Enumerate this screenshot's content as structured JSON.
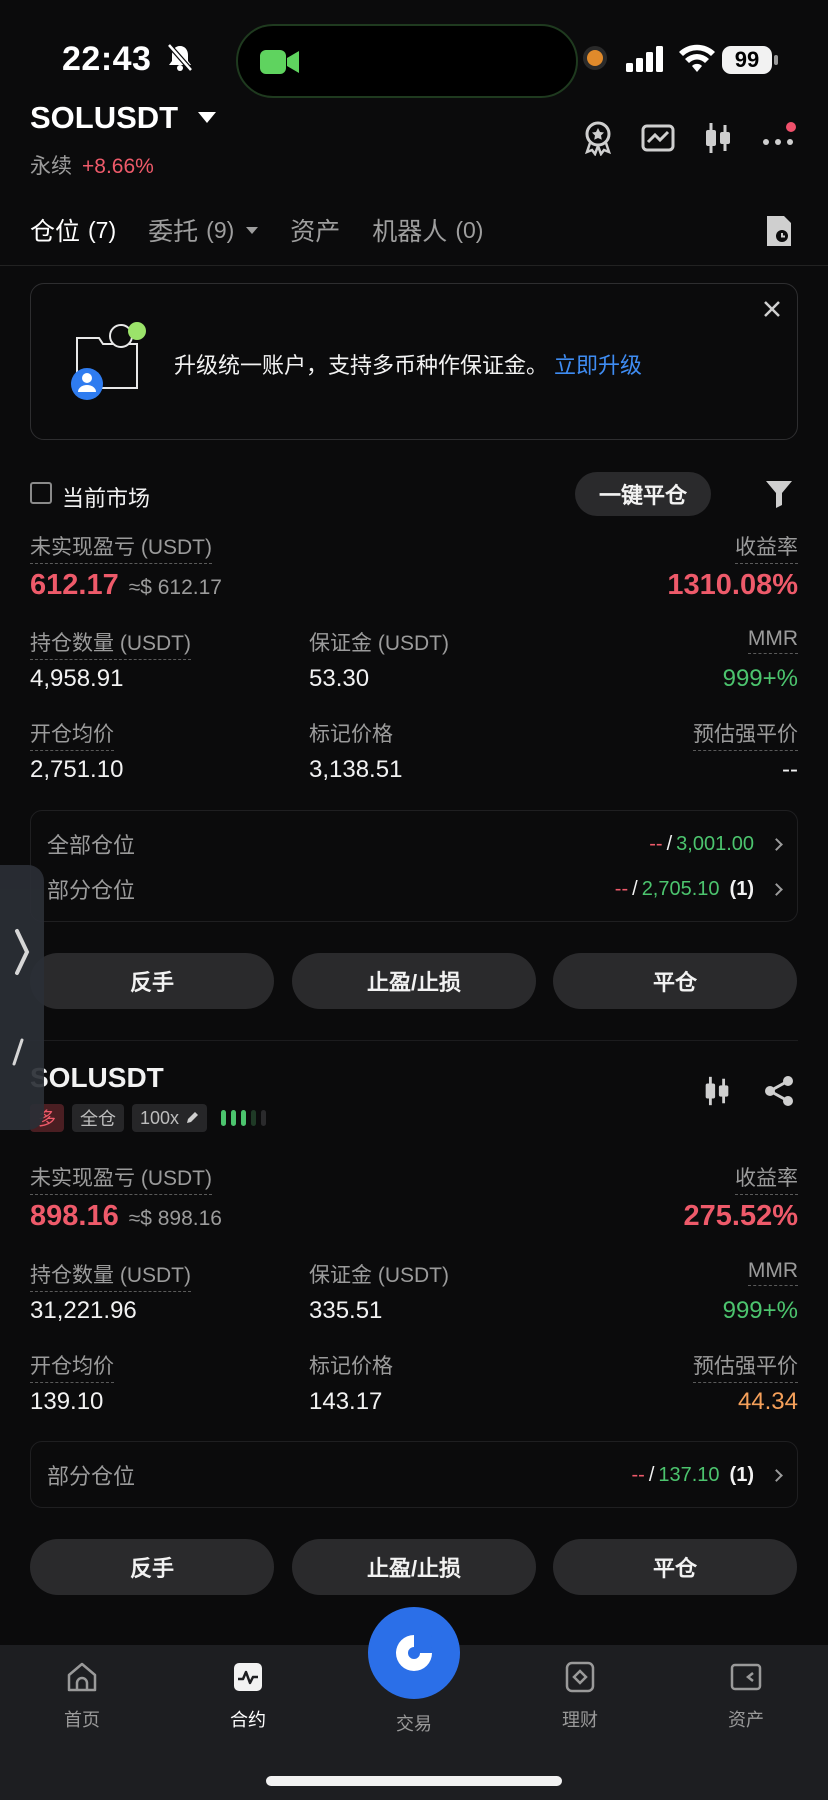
{
  "status_bar": {
    "time": "22:43",
    "battery": "99"
  },
  "header": {
    "symbol": "SOLUSDT",
    "type": "永续",
    "change": "+8.66%"
  },
  "tabs": [
    {
      "label": "仓位",
      "count": "(7)"
    },
    {
      "label": "委托",
      "count": "(9)"
    },
    {
      "label": "资产",
      "count": ""
    },
    {
      "label": "机器人",
      "count": "(0)"
    }
  ],
  "banner": {
    "text": "升级统一账户，支持多币种作保证金。",
    "link": "立即升级"
  },
  "filter_row": {
    "current_market": "当前市场",
    "close_all": "一键平仓"
  },
  "labels": {
    "unrealized": "未实现盈亏 (USDT)",
    "roe": "收益率",
    "size": "持仓数量 (USDT)",
    "margin": "保证金 (USDT)",
    "mmr": "MMR",
    "entry": "开仓均价",
    "mark": "标记价格",
    "liq": "预估强平价"
  },
  "position1": {
    "pnl": "612.17",
    "pnl_approx": "≈$ 612.17",
    "roe": "1310.08%",
    "size": "4,958.91",
    "margin": "53.30",
    "mmr": "999+%",
    "entry": "2,751.10",
    "mark": "3,138.51",
    "liq": "--",
    "tpsl": [
      {
        "name": "全部仓位",
        "sl": "--",
        "tp": "3,001.00",
        "qty": ""
      },
      {
        "name": "部分仓位",
        "sl": "--",
        "tp": "2,705.10",
        "qty": "(1)"
      }
    ]
  },
  "position2": {
    "symbol": "SOLUSDT",
    "side": "多",
    "mode": "全仓",
    "leverage": "100x",
    "pnl": "898.16",
    "pnl_approx": "≈$ 898.16",
    "roe": "275.52%",
    "size": "31,221.96",
    "margin": "335.51",
    "mmr": "999+%",
    "entry": "139.10",
    "mark": "143.17",
    "liq": "44.34",
    "tpsl": [
      {
        "name": "部分仓位",
        "sl": "--",
        "tp": "137.10",
        "qty": "(1)"
      }
    ]
  },
  "buttons": {
    "reverse": "反手",
    "tpsl": "止盈/止损",
    "close": "平仓"
  },
  "tpsl_sep": "/",
  "nav": [
    {
      "label": "首页",
      "icon": "home-icon"
    },
    {
      "label": "合约",
      "icon": "futures-icon"
    },
    {
      "label": "交易",
      "icon": "trade-icon"
    },
    {
      "label": "理财",
      "icon": "earn-icon"
    },
    {
      "label": "资产",
      "icon": "wallet-icon"
    }
  ],
  "colors": {
    "red": "#ee5a6a",
    "green": "#4cc46e",
    "orange": "#f5a05a",
    "accent": "#2b6fe8",
    "link": "#3f8cf2"
  }
}
